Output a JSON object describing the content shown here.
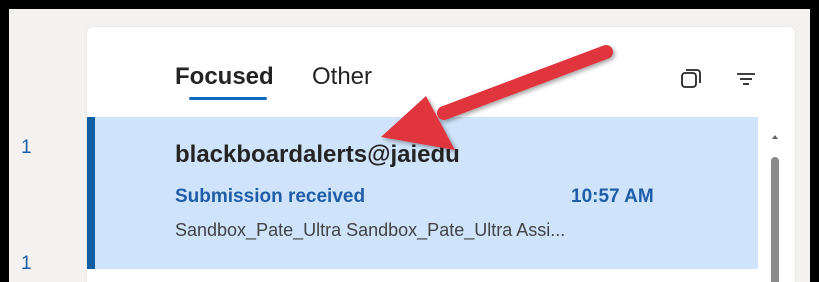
{
  "left_rail": {
    "count_top": "1",
    "count_bottom": "1"
  },
  "tabs": {
    "focused_label": "Focused",
    "other_label": "Other"
  },
  "toolbar": {
    "select_icon": "select-icon",
    "filter_icon": "filter-icon"
  },
  "message": {
    "sender": "blackboardalerts@jaiedu",
    "subject": "Submission received",
    "time": "10:57 AM",
    "preview": "Sandbox_Pate_Ultra Sandbox_Pate_Ultra Assi..."
  },
  "annotation": {
    "icon": "red-arrow-icon",
    "color": "#e0343e"
  },
  "colors": {
    "accent": "#0f6cbd",
    "selected_bg": "#cfe4fa",
    "unread_text": "#1f5da8"
  }
}
